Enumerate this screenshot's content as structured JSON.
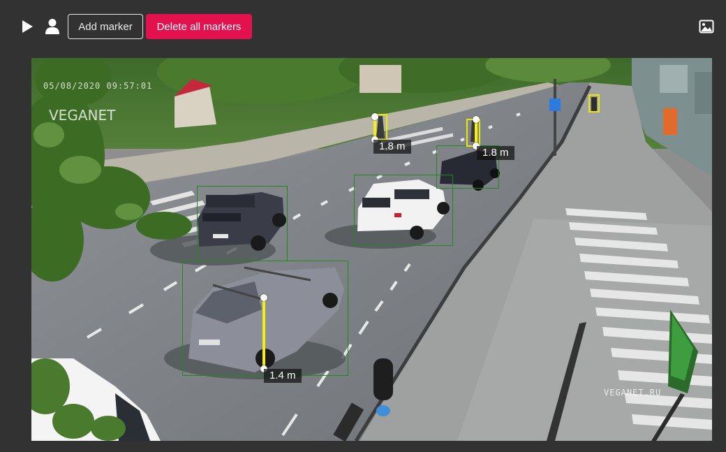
{
  "toolbar": {
    "play_icon": "play-icon",
    "person_icon": "person-icon",
    "add_marker_label": "Add marker",
    "delete_all_label": "Delete all markers",
    "image_icon": "image-icon",
    "delete_color": "#e3124f"
  },
  "camera": {
    "timestamp": "05/08/2020 09:57:01",
    "watermark_top": "VEGANET",
    "watermark_bottom": "VEGANET.RU"
  },
  "markers": [
    {
      "label": "1.8 m"
    },
    {
      "label": "1.8 m"
    },
    {
      "label": "1.4 m"
    }
  ],
  "detections": {
    "vehicles": 4,
    "pedestrians": 3
  }
}
